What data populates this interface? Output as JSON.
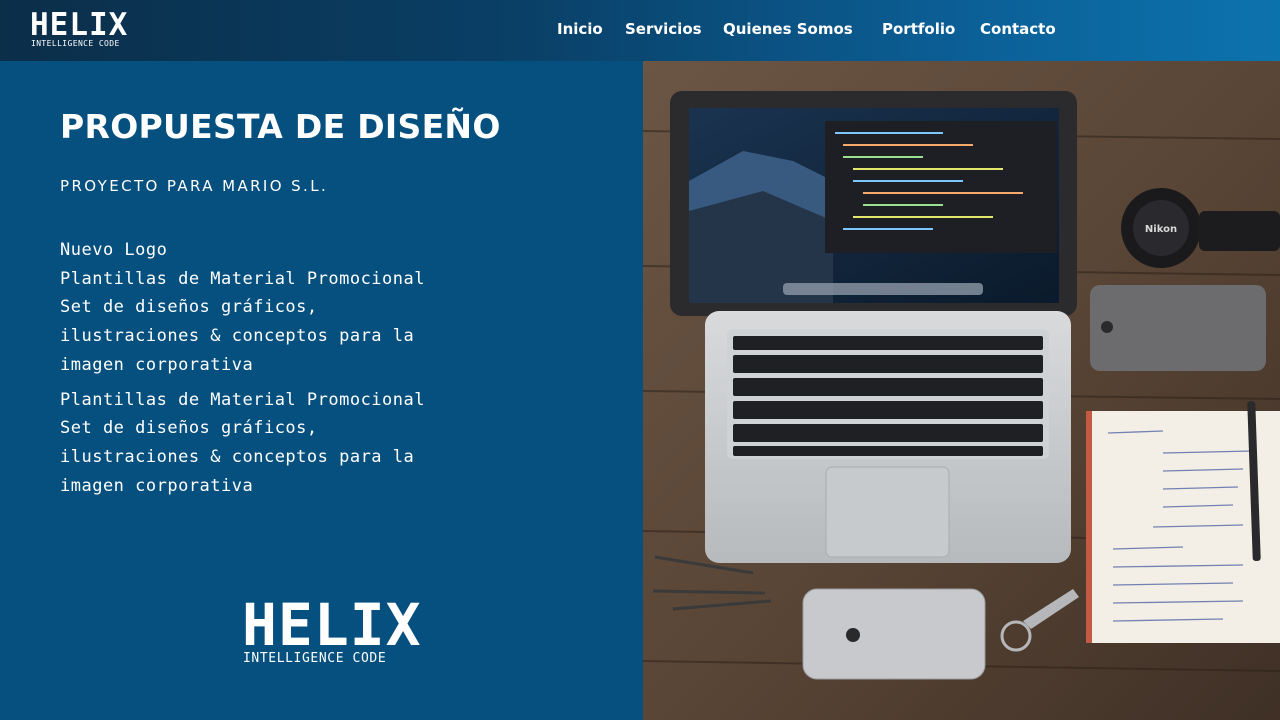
{
  "brand": {
    "name": "HELIX",
    "tagline": "INTELLIGENCE CODE"
  },
  "nav": {
    "items": [
      {
        "label": "Inicio"
      },
      {
        "label": "Servicios"
      },
      {
        "label": "Quienes Somos"
      },
      {
        "label": "Portfolio"
      },
      {
        "label": "Contacto"
      }
    ]
  },
  "main": {
    "title": "PROPUESTA DE DISEÑO",
    "subtitle": "PROYECTO PARA MARIO S.L.",
    "items": [
      "Nuevo Logo",
      "Plantillas de Material Promocional",
      "Set de diseños gráficos,",
      "ilustraciones & conceptos para la",
      "imagen corporativa",
      "Plantillas de Material Promocional",
      "Set de diseños gráficos,",
      "ilustraciones & conceptos para la",
      "imagen corporativa"
    ]
  },
  "photo": {
    "camera_brand": "Nikon"
  },
  "colors": {
    "panel_blue": "#06507f",
    "header_dark": "#0b2e49",
    "header_light": "#0d73ad",
    "text": "#ffffff"
  }
}
